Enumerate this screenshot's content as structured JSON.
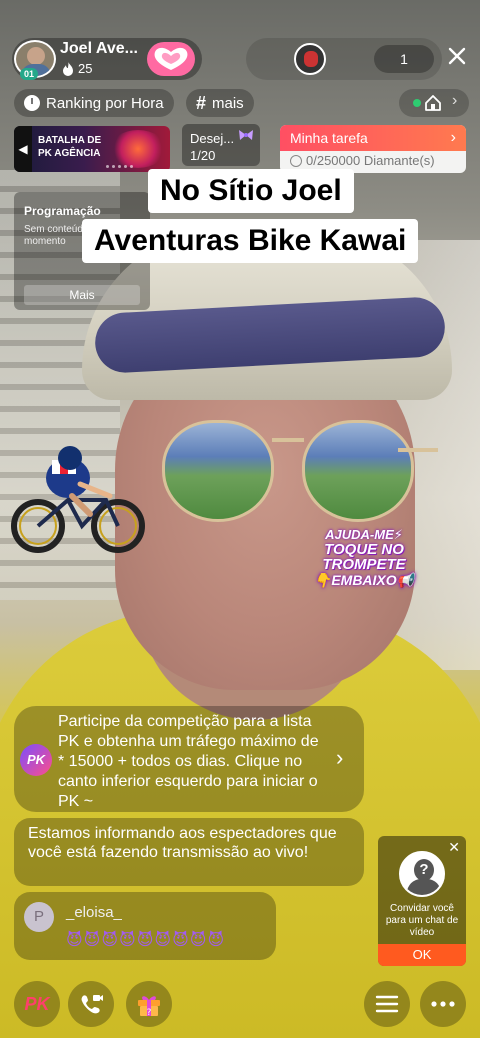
{
  "host": {
    "name": "Joel Ave...",
    "level": "01",
    "fans": "25"
  },
  "viewers": {
    "count": "1"
  },
  "chips": {
    "ranking": "Ranking por Hora",
    "more": "mais"
  },
  "banners": {
    "pk_line1": "BATALHA DE",
    "pk_line2": "PK AGÊNCIA",
    "wish_label": "Desej...",
    "wish_progress": "1/20",
    "task_title": "Minha tarefa",
    "task_progress": "0/250000 Diamante(s)"
  },
  "program": {
    "title": "Programação",
    "desc": "Sem conteúdo no momento",
    "more": "Mais"
  },
  "overlay": {
    "line1": "No Sítio Joel",
    "line2": "Aventuras Bike Kawai"
  },
  "trumpet_hint": {
    "line1": "AJUDA-ME⚡",
    "line2": "TOQUE NO TROMPETE",
    "line3": "👇EMBAIXO📢"
  },
  "chat": {
    "pk_badge": "PK",
    "pk_message": "Participe da competição para a lista PK e obtenha um tráfego máximo de * 15000 + todos os dias. Clique no canto inferior esquerdo para iniciar o PK ~",
    "live_message": "Estamos informando aos espectadores que você está fazendo transmissão ao vivo!",
    "user_initial": "P",
    "user_name": "_eloisa_",
    "user_message": "😈😈😈😈😈😈😈😈😈"
  },
  "invite": {
    "text": "Convidar você para um chat de vídeo",
    "button": "OK"
  },
  "bottom": {
    "pk": "PK"
  },
  "colors": {
    "accent_pink": "#ff6aa2",
    "task_red": "#ff4f63",
    "invite_orange": "#ff5a1f",
    "online_green": "#2ecc71"
  },
  "icons": [
    "clock-icon",
    "hash-icon",
    "home-icon",
    "close-icon",
    "heart-lips-icon",
    "fire-icon",
    "video-call-icon",
    "gift-icon",
    "menu-icon",
    "more-icon"
  ]
}
